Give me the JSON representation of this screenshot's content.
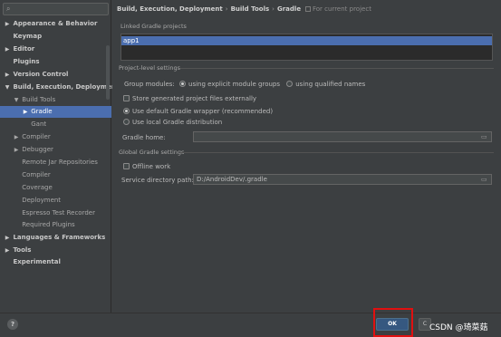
{
  "sidebar": {
    "search_icon": "magnifier-icon",
    "items": [
      {
        "label": "Appearance & Behavior",
        "arrow": "▶"
      },
      {
        "label": "Keymap",
        "arrow": ""
      },
      {
        "label": "Editor",
        "arrow": "▶"
      },
      {
        "label": "Plugins",
        "arrow": ""
      },
      {
        "label": "Version Control",
        "arrow": "▶"
      },
      {
        "label": "Build, Execution, Deployment",
        "arrow": "▼"
      },
      {
        "label": "Build Tools",
        "arrow": "▼"
      },
      {
        "label": "Gradle",
        "arrow": "▶"
      },
      {
        "label": "Gant",
        "arrow": ""
      },
      {
        "label": "Compiler",
        "arrow": "▶"
      },
      {
        "label": "Debugger",
        "arrow": "▶"
      },
      {
        "label": "Remote Jar Repositories",
        "arrow": ""
      },
      {
        "label": "Compiler",
        "arrow": ""
      },
      {
        "label": "Coverage",
        "arrow": ""
      },
      {
        "label": "Deployment",
        "arrow": ""
      },
      {
        "label": "Espresso Test Recorder",
        "arrow": ""
      },
      {
        "label": "Required Plugins",
        "arrow": ""
      },
      {
        "label": "Languages & Frameworks",
        "arrow": "▶"
      },
      {
        "label": "Tools",
        "arrow": "▶"
      },
      {
        "label": "Experimental",
        "arrow": ""
      }
    ]
  },
  "breadcrumb": {
    "part1": "Build, Execution, Deployment",
    "sep": "›",
    "part2": "Build Tools",
    "part3": "Gradle",
    "scope": "For current project"
  },
  "linked_projects": {
    "title": "Linked Gradle projects",
    "items": [
      "app1"
    ]
  },
  "project_settings": {
    "title": "Project-level settings",
    "group_modules_label": "Group modules:",
    "option_explicit": "using explicit module groups",
    "option_qualified": "using qualified names",
    "store_externally": "Store generated project files externally",
    "use_wrapper": "Use default Gradle wrapper (recommended)",
    "use_local": "Use local Gradle distribution",
    "gradle_home_label": "Gradle home:",
    "gradle_home_value": ""
  },
  "global_settings": {
    "title": "Global Gradle settings",
    "offline_work": "Offline work",
    "service_dir_label": "Service directory path:",
    "service_dir_value": "D:/AndroidDev/.gradle"
  },
  "footer": {
    "help": "?",
    "ok": "OK",
    "cancel": "C",
    "watermark": "CSDN @琦菜菇"
  },
  "colors": {
    "selection": "#4b6eaf",
    "ok_button": "#365880",
    "highlight_box": "#e01010"
  }
}
